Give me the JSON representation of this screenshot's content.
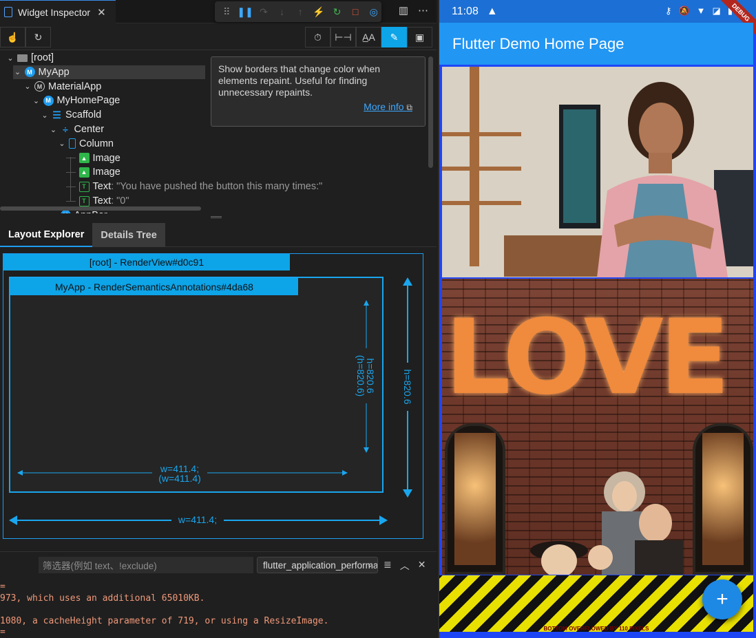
{
  "editor_tab": {
    "title": "Widget Inspector",
    "close": "✕"
  },
  "debug_toolbar": {
    "buttons": [
      {
        "name": "drag-handle",
        "glyph": "⠿",
        "color": "#888888"
      },
      {
        "name": "pause",
        "glyph": "❚❚",
        "color": "#3ea8ff"
      },
      {
        "name": "step-over",
        "glyph": "↷",
        "color": "#555555"
      },
      {
        "name": "step-into",
        "glyph": "↓",
        "color": "#555555"
      },
      {
        "name": "step-out",
        "glyph": "↑",
        "color": "#555555"
      },
      {
        "name": "hot-reload",
        "glyph": "⚡",
        "color": "#f5b800"
      },
      {
        "name": "hot-restart",
        "glyph": "↻",
        "color": "#3fb950"
      },
      {
        "name": "stop",
        "glyph": "□",
        "color": "#f05a3c"
      },
      {
        "name": "devtools",
        "glyph": "◎",
        "color": "#3ea8ff"
      }
    ]
  },
  "tab_actions": {
    "split": "▥",
    "more": "⋯"
  },
  "inspector_toolbar": {
    "left": [
      {
        "name": "select-widget-mode",
        "glyph": "☝"
      },
      {
        "name": "refresh-tree",
        "glyph": "↻"
      }
    ],
    "right": [
      {
        "name": "slow-animations",
        "glyph": "⏱",
        "active": false
      },
      {
        "name": "show-guidelines",
        "glyph": "⊢⊣",
        "active": false
      },
      {
        "name": "show-baselines",
        "glyph": "A̲A",
        "active": false
      },
      {
        "name": "highlight-repaints",
        "glyph": "✎",
        "active": true
      },
      {
        "name": "highlight-oversized-images",
        "glyph": "▣",
        "active": false
      }
    ]
  },
  "widget_tree": {
    "nodes": [
      {
        "label": "[root]",
        "desc": "",
        "depth": 0,
        "icon": "folder",
        "chev": "⌄"
      },
      {
        "label": "MyApp",
        "desc": "",
        "depth": 1,
        "icon": "m",
        "chev": "⌄",
        "selected": true
      },
      {
        "label": "MaterialApp",
        "desc": "",
        "depth": 2,
        "icon": "mat",
        "chev": "⌄"
      },
      {
        "label": "MyHomePage",
        "desc": "",
        "depth": 3,
        "icon": "m",
        "chev": "⌄"
      },
      {
        "label": "Scaffold",
        "desc": "",
        "depth": 4,
        "icon": "scaffold",
        "chev": "⌄"
      },
      {
        "label": "Center",
        "desc": "",
        "depth": 5,
        "icon": "center",
        "chev": "⌄"
      },
      {
        "label": "Column",
        "desc": "",
        "depth": 6,
        "icon": "col",
        "chev": "⌄"
      },
      {
        "label": "Image",
        "desc": "",
        "depth": 7,
        "icon": "img",
        "chev": ""
      },
      {
        "label": "Image",
        "desc": "",
        "depth": 7,
        "icon": "img",
        "chev": ""
      },
      {
        "label": "Text",
        "desc": ": \"You have pushed the button this many times:\"",
        "depth": 7,
        "icon": "txt",
        "chev": ""
      },
      {
        "label": "Text",
        "desc": ": \"0\"",
        "depth": 7,
        "icon": "txt",
        "chev": ""
      },
      {
        "label": "AppBar",
        "desc": "",
        "depth": 5,
        "icon": "m",
        "chev": "⌄"
      }
    ]
  },
  "tooltip": {
    "text": "Show borders that change color when elements repaint. Useful for finding unnecessary repaints.",
    "link": "More info",
    "link_icon": "⧉"
  },
  "bottom_tabs": {
    "layout_explorer": "Layout Explorer",
    "details_tree": "Details Tree"
  },
  "layout_explorer": {
    "root_label": "[root] - RenderView#d0c91",
    "child_label": "MyApp - RenderSemanticsAnnotations#4da68",
    "inner_height": "h=820.6",
    "inner_height_paren": "(h=820.6)",
    "inner_width": "w=411.4;",
    "inner_width_paren": "(w=411.4)",
    "outer_height": "h=820.6",
    "outer_width": "w=411.4;"
  },
  "console": {
    "filter_placeholder": "筛选器(例如 text、!exclude)",
    "selected_target": "flutter_application_performance",
    "lines": [
      "=",
      "973, which uses an additional 65010KB.",
      "",
      "1080, a cacheHeight parameter of 719, or using a ResizeImage.",
      "="
    ]
  },
  "phone": {
    "time": "11:08",
    "status_icons": [
      "⚷",
      "🔕",
      "▼",
      "◪",
      "▮"
    ],
    "debug_banner": "DEBUG",
    "app_title": "Flutter Demo Home Page",
    "love_sign": "LOVE",
    "overflow_message": "BOTTOM OVERFLOWED BY 110 PIXELS",
    "fab_label": "+",
    "colors": {
      "app_bar": "#2196f3",
      "status_bar": "#1c6fd4",
      "fab": "#1e88e5"
    }
  }
}
